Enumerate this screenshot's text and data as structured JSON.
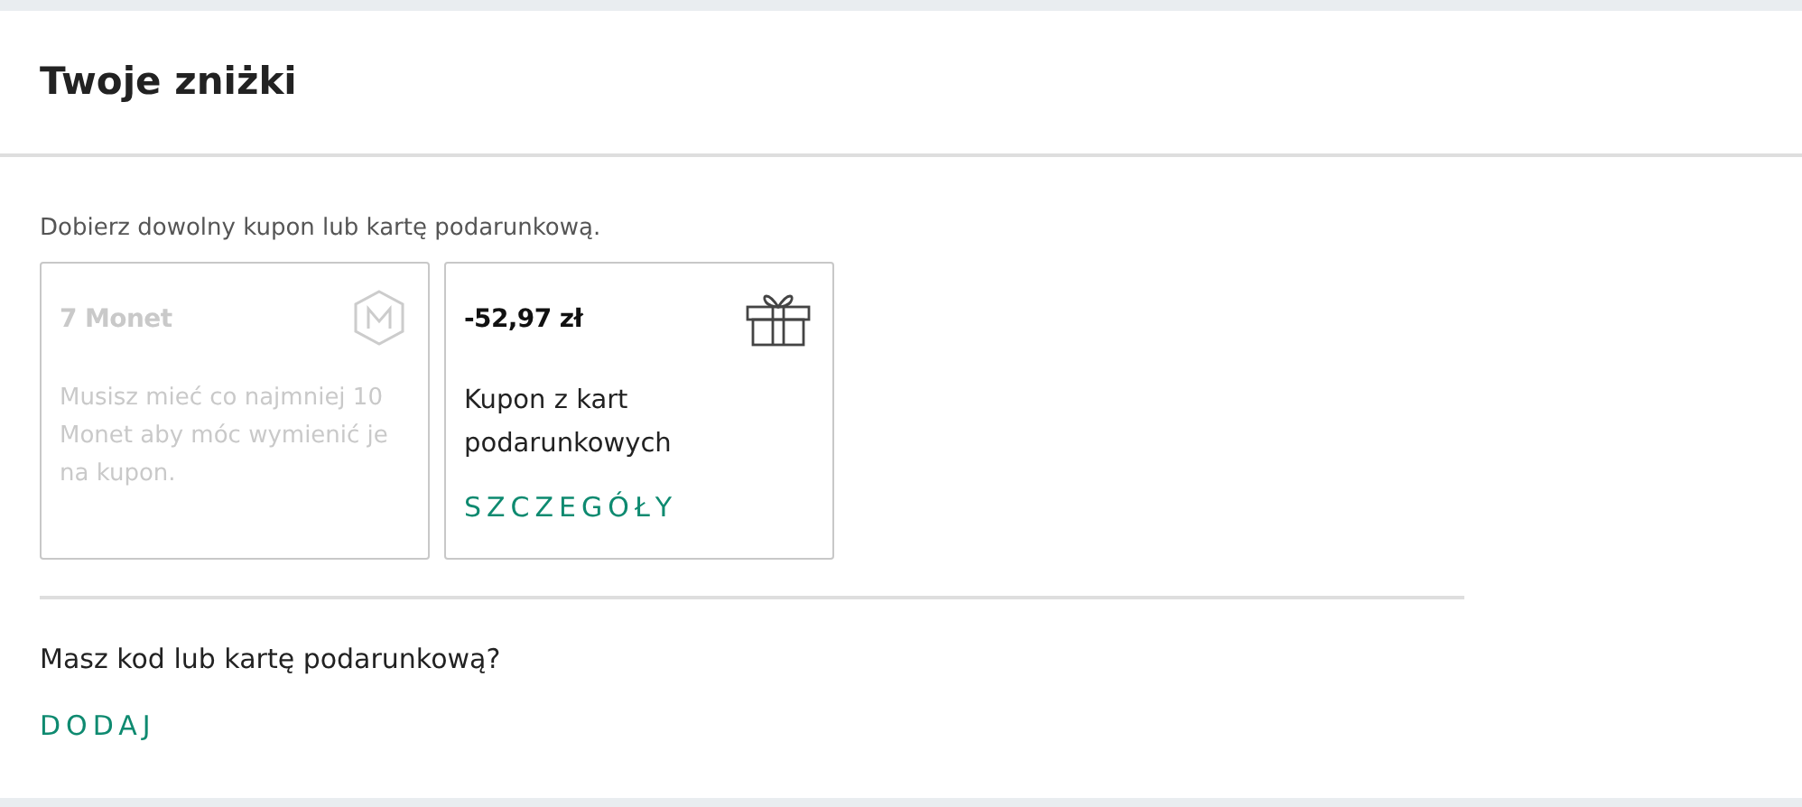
{
  "title": "Twoje zniżki",
  "intro": "Dobierz dowolny kupon lub kartę podarunkową.",
  "coupons": [
    {
      "kind": "coin",
      "title": "7 Monet",
      "description": "Musisz mieć co najmniej 10 Monet aby móc wymienić je na kupon.",
      "disabled": true
    },
    {
      "kind": "gift",
      "title": "-52,97 zł",
      "description": "Kupon z kart podarunkowych",
      "link": "SZCZEGÓŁY",
      "disabled": false
    }
  ],
  "question": "Masz kod lub kartę podarunkową?",
  "add_link": "DODAJ"
}
